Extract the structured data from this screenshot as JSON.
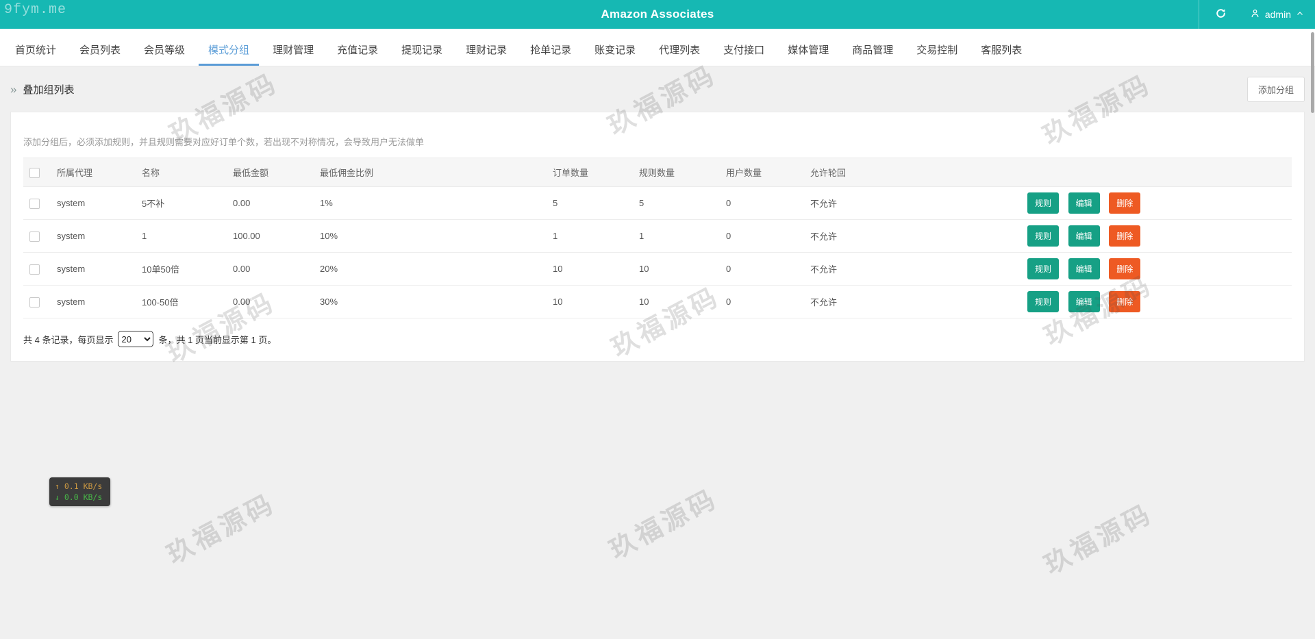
{
  "site_watermark": "9fym.me",
  "watermark_text": "玖福源码",
  "topbar": {
    "title": "Amazon Associates",
    "username": "admin"
  },
  "nav": {
    "tabs": [
      "首页统计",
      "会员列表",
      "会员等级",
      "模式分组",
      "理财管理",
      "充值记录",
      "提现记录",
      "理财记录",
      "抢单记录",
      "账变记录",
      "代理列表",
      "支付接口",
      "媒体管理",
      "商品管理",
      "交易控制",
      "客服列表"
    ],
    "active_tab": "模式分组"
  },
  "breadcrumb": {
    "icon": "»",
    "title": "叠加组列表"
  },
  "actions": {
    "add_group": "添加分组"
  },
  "panel": {
    "notice": "添加分组后，必须添加规则，并且规则需要对应好订单个数，若出现不对称情况，会导致用户无法做单",
    "table": {
      "headers": [
        "所属代理",
        "名称",
        "最低金额",
        "最低佣金比例",
        "订单数量",
        "规则数量",
        "用户数量",
        "允许轮回"
      ],
      "row_buttons": {
        "rules": "规则",
        "edit": "编辑",
        "delete": "删除"
      },
      "rows": [
        {
          "agent": "system",
          "name": "5不补",
          "min_amount": "0.00",
          "min_commission": "1%",
          "orders": "5",
          "rules": "5",
          "users": "0",
          "loop": "不允许"
        },
        {
          "agent": "system",
          "name": "1",
          "min_amount": "100.00",
          "min_commission": "10%",
          "orders": "1",
          "rules": "1",
          "users": "0",
          "loop": "不允许"
        },
        {
          "agent": "system",
          "name": "10单50倍",
          "min_amount": "0.00",
          "min_commission": "20%",
          "orders": "10",
          "rules": "10",
          "users": "0",
          "loop": "不允许"
        },
        {
          "agent": "system",
          "name": "100-50倍",
          "min_amount": "0.00",
          "min_commission": "30%",
          "orders": "10",
          "rules": "10",
          "users": "0",
          "loop": "不允许"
        }
      ]
    },
    "pagination": {
      "prefix": "共 4 条记录，每页显示",
      "page_size": "20",
      "suffix": "条，共 1 页当前显示第 1 页。"
    }
  },
  "net_monitor": {
    "up_arrow": "↑",
    "up": "0.1 KB/s",
    "down_arrow": "↓",
    "down": "0.0 KB/s"
  },
  "colors": {
    "topbar_teal": "#16b8b3",
    "active_tab_blue": "#5e9fd8",
    "button_teal": "#16a085",
    "button_orange": "#ee5a23",
    "net_up_orange": "#cf9b42",
    "net_down_green": "#48b948"
  }
}
